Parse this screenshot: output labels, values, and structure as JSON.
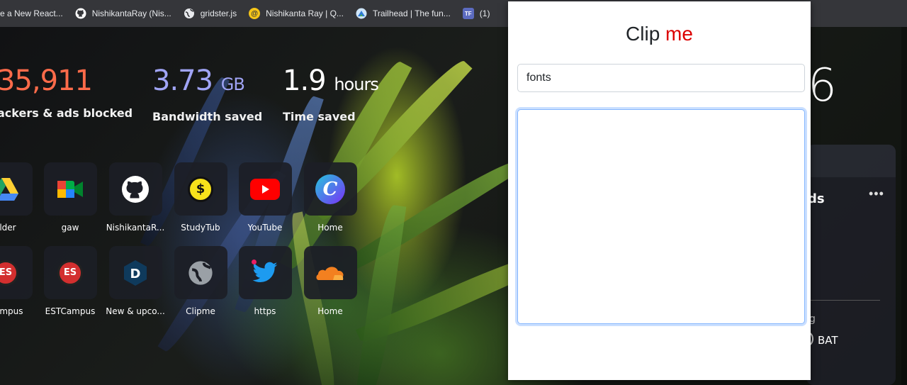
{
  "bookmarks": [
    {
      "label": "e a New React...",
      "icon": "react-icon",
      "color": "#61dafb",
      "glyph": ""
    },
    {
      "label": "NishikantaRay (Nis...",
      "icon": "github-icon",
      "color": "#ffffff",
      "glyph": "●"
    },
    {
      "label": "gridster.js",
      "icon": "globe-icon",
      "color": "#ffffff",
      "glyph": "◍"
    },
    {
      "label": "Nishikanta Ray | Q...",
      "icon": "quora-icon",
      "color": "#f5c518",
      "glyph": "@"
    },
    {
      "label": "Trailhead | The fun...",
      "icon": "trailhead-icon",
      "color": "#7ab8f5",
      "glyph": "▲"
    },
    {
      "label": "(1)",
      "icon": "tf-icon",
      "color": "#5c6bc0",
      "glyph": "TF"
    }
  ],
  "stats": [
    {
      "value": "35,911",
      "unit": "",
      "label": "ackers & ads blocked",
      "color": "#ff6b4a"
    },
    {
      "value": "3.73",
      "unit": "GB",
      "label": "Bandwidth saved",
      "color": "#a0a4f5"
    },
    {
      "value": "1.9",
      "unit": "hours",
      "label": "Time saved",
      "color": "#ffffff"
    }
  ],
  "tiles_row1": [
    {
      "label": "older",
      "icon": "google-drive-icon"
    },
    {
      "label": "gaw",
      "icon": "google-meet-icon"
    },
    {
      "label": "NishikantaR...",
      "icon": "github-icon"
    },
    {
      "label": "StudyTub",
      "icon": "studytub-icon"
    },
    {
      "label": "YouTube",
      "icon": "youtube-icon"
    },
    {
      "label": "Home",
      "icon": "canva-icon"
    }
  ],
  "tiles_row2": [
    {
      "label": "ampus",
      "icon": "estcampus-icon"
    },
    {
      "label": "ESTCampus",
      "icon": "estcampus-icon"
    },
    {
      "label": "New & upco...",
      "icon": "d-logo-icon"
    },
    {
      "label": "Clipme",
      "icon": "globe-icon"
    },
    {
      "label": "https",
      "icon": "twitter-icon"
    },
    {
      "label": "Home",
      "icon": "cloudflare-icon"
    }
  ],
  "right_widget": {
    "time_digit": "6",
    "card_title": "ds",
    "menu": "•••",
    "small_text": "g",
    "bat_label": "BAT"
  },
  "popup": {
    "title_main": "Clip",
    "title_accent": "me",
    "input_value": "fonts",
    "textarea_value": "",
    "accent_color": "#dc0000"
  }
}
